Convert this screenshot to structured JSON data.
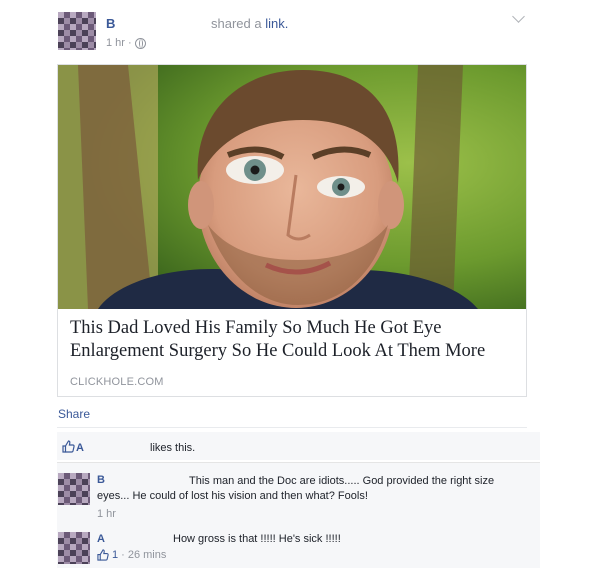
{
  "post": {
    "author": "B",
    "action_text": "shared a ",
    "action_link": "link.",
    "time": "1 hr · ",
    "privacy_icon": "globe-icon"
  },
  "card": {
    "image_description_icon": "link-preview-photo",
    "title": "This Dad Loved His Family So Much He Got Eye Enlargement Surgery So He Could Look At Them More",
    "source": "CLICKHOLE.COM"
  },
  "actions": {
    "share": "Share"
  },
  "likes": {
    "icon": "thumbs-up-icon",
    "name": "A",
    "text": "likes this."
  },
  "comments": [
    {
      "author": "B",
      "text": "This man and the Doc are idiots..... God provided the right size eyes... He could of lost his vision and then what? Fools!",
      "time": "1 hr"
    },
    {
      "author": "A",
      "text": "How gross is that !!!!! He's sick !!!!!",
      "likes": "1",
      "time": " · 26 mins"
    }
  ],
  "colors": {
    "link": "#3b5998",
    "meta": "#90949c",
    "comment_bg": "#f6f7f9"
  }
}
